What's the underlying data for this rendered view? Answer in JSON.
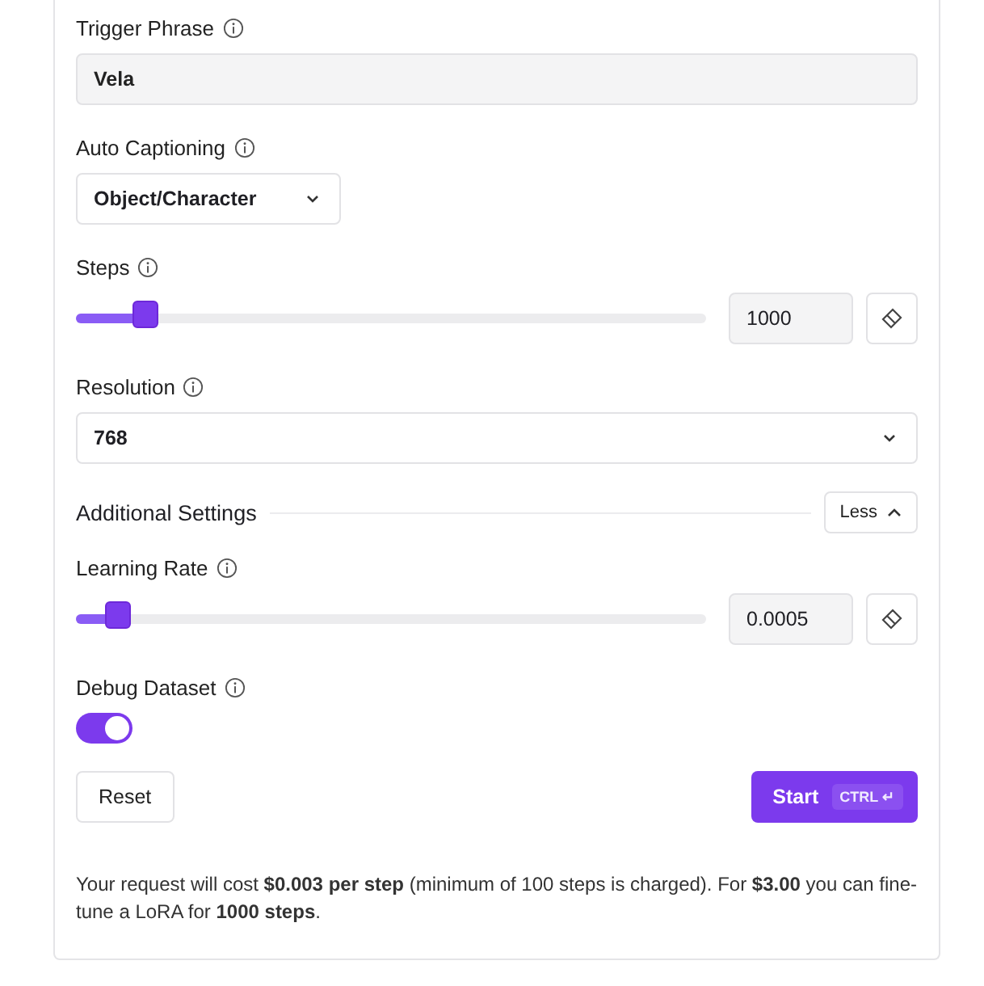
{
  "fields": [
    {
      "kind": "text",
      "label": "Trigger Phrase",
      "value": "Vela"
    },
    {
      "kind": "select",
      "label": "Auto Captioning",
      "value": "Object/Character",
      "compact": true
    },
    {
      "kind": "slider",
      "label": "Steps",
      "level": 0.11,
      "value": "1000"
    },
    {
      "kind": "select",
      "label": "Resolution",
      "value": "768",
      "compact": false
    }
  ],
  "additional_settings": {
    "title": "Additional Settings",
    "toggle_label": "Less",
    "expanded": true,
    "fields": [
      {
        "kind": "slider",
        "label": "Learning Rate",
        "level": 0.066,
        "value": "0.0005"
      },
      {
        "kind": "switch",
        "label": "Debug Dataset",
        "on": true
      }
    ]
  },
  "actions": {
    "reset": "Reset",
    "start": "Start",
    "shortcut": "CTRL ↵"
  },
  "footer": "Your request will cost **$0.003 per step** (minimum of 100 steps is charged). For **$3.00** you can fine-tune a LoRA for **1000 steps**."
}
